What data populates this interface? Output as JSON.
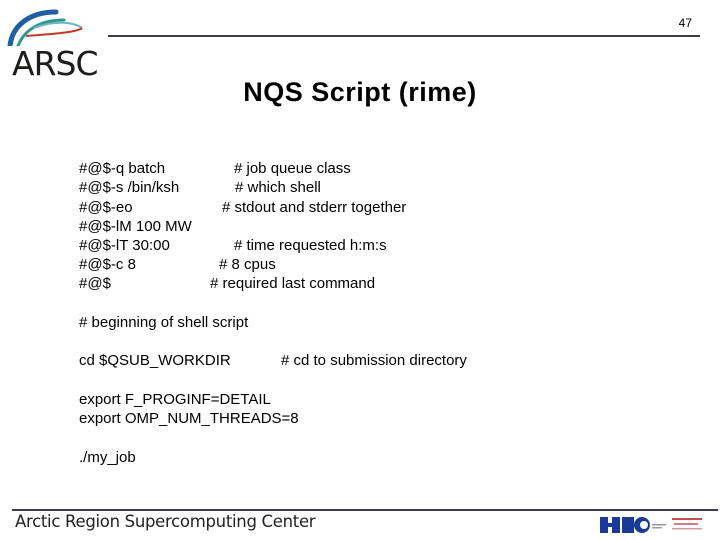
{
  "header": {
    "logo_text": "ARSC",
    "page_number": "47"
  },
  "slide": {
    "title": "NQS Script (rime)"
  },
  "directives": [
    {
      "command": "#@$-q batch",
      "comment": "# job queue class"
    },
    {
      "command": "#@$-s /bin/ksh",
      "comment": "# which shell"
    },
    {
      "command": "#@$-eo",
      "comment": "# stdout and stderr together"
    },
    {
      "command": "#@$-lM 100 MW",
      "comment": ""
    },
    {
      "command": "#@$-lT 30:00",
      "comment": "# time requested h:m:s"
    },
    {
      "command": "#@$-c 8",
      "comment": "# 8 cpus"
    },
    {
      "command": "#@$",
      "comment": "# required last command"
    }
  ],
  "script": {
    "begin_comment": "# beginning of shell script",
    "cd_command": "cd $QSUB_WORKDIR",
    "cd_comment": "# cd to submission directory",
    "export_1": "export F_PROGINF=DETAIL",
    "export_2": "export OMP_NUM_THREADS=8",
    "run": "./my_job"
  },
  "footer": {
    "org_name": "Arctic Region Supercomputing Center",
    "partner_logo": "HPC"
  },
  "colors": {
    "logo_blue": "#1f5fa8",
    "logo_teal": "#2a9a8a",
    "logo_red": "#c0392b",
    "hpc_blue": "#1a3a9a",
    "hpc_red": "#c0504d"
  }
}
